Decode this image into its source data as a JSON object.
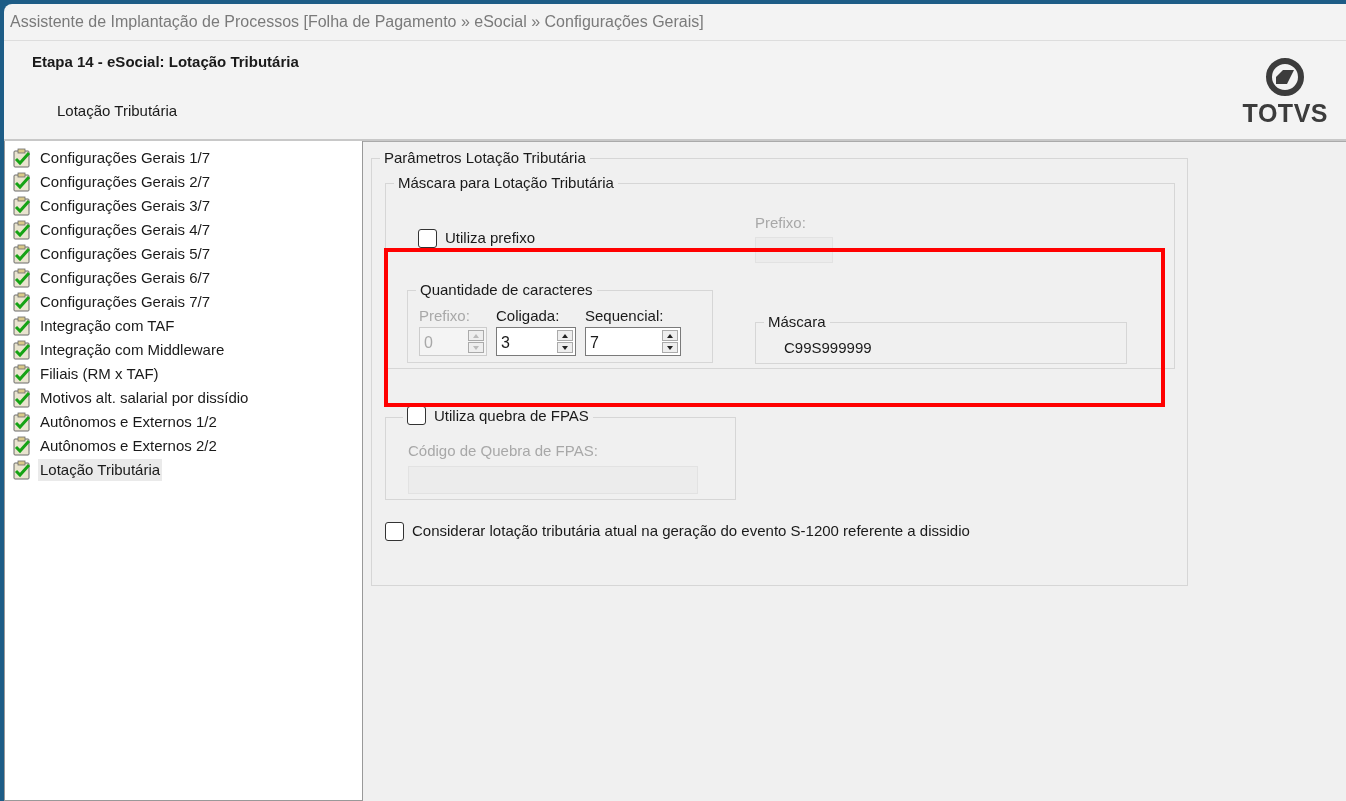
{
  "window": {
    "title": "Assistente de Implantação de Processos [Folha de Pagamento » eSocial » Configurações Gerais]"
  },
  "header": {
    "title": "Etapa 14 - eSocial: Lotação Tributária",
    "subtitle": "Lotação Tributária",
    "logo_text": "TOTVS"
  },
  "steps": [
    {
      "label": "Configurações Gerais 1/7",
      "selected": false
    },
    {
      "label": "Configurações Gerais 2/7",
      "selected": false
    },
    {
      "label": "Configurações Gerais 3/7",
      "selected": false
    },
    {
      "label": "Configurações Gerais 4/7",
      "selected": false
    },
    {
      "label": "Configurações Gerais 5/7",
      "selected": false
    },
    {
      "label": "Configurações Gerais 6/7",
      "selected": false
    },
    {
      "label": "Configurações Gerais 7/7",
      "selected": false
    },
    {
      "label": "Integração com TAF",
      "selected": false
    },
    {
      "label": "Integração com Middleware",
      "selected": false
    },
    {
      "label": "Filiais (RM x TAF)",
      "selected": false
    },
    {
      "label": "Motivos alt. salarial por dissídio",
      "selected": false
    },
    {
      "label": "Autônomos e Externos 1/2",
      "selected": false
    },
    {
      "label": "Autônomos e Externos 2/2",
      "selected": false
    },
    {
      "label": "Lotação Tributária",
      "selected": true
    }
  ],
  "parameters": {
    "title": "Parâmetros Lotação Tributária",
    "mask_group": {
      "title": "Máscara para Lotação Tributária",
      "use_prefix": {
        "label": "Utiliza prefixo",
        "checked": false
      },
      "prefix_field": {
        "label": "Prefixo:",
        "disabled": true
      },
      "quantity": {
        "title": "Quantidade de caracteres",
        "fields": [
          {
            "label": "Prefixo:",
            "value": "0",
            "disabled": true
          },
          {
            "label": "Coligada:",
            "value": "3",
            "disabled": false
          },
          {
            "label": "Sequencial:",
            "value": "7",
            "disabled": false
          }
        ]
      },
      "mask": {
        "title": "Máscara",
        "value": "C99S999999"
      }
    },
    "fpas_group": {
      "checkbox": {
        "label": "Utiliza quebra de FPAS",
        "checked": false
      },
      "field": {
        "label": "Código de Quebra de FPAS:",
        "disabled": true
      }
    },
    "consider_current": {
      "label": "Considerar lotação tributária atual na geração do evento S-1200 referente a dissidio",
      "checked": false
    }
  }
}
